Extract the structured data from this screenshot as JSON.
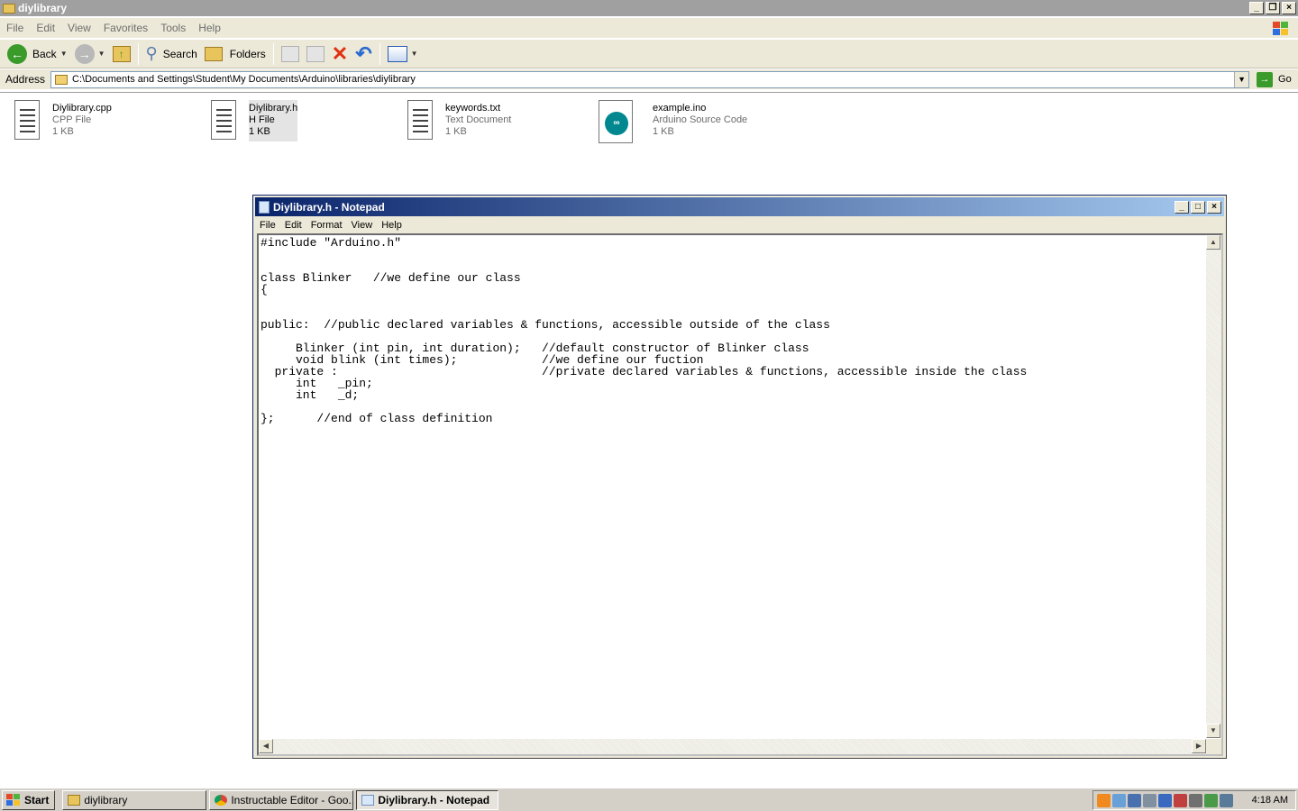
{
  "explorer": {
    "title": "diylibrary",
    "menu": [
      "File",
      "Edit",
      "View",
      "Favorites",
      "Tools",
      "Help"
    ],
    "toolbar": {
      "back": "Back",
      "search": "Search",
      "folders": "Folders"
    },
    "address": {
      "label": "Address",
      "value": "C:\\Documents and Settings\\Student\\My Documents\\Arduino\\libraries\\diylibrary",
      "go": "Go"
    },
    "files": [
      {
        "name": "Diylibrary.cpp",
        "type": "CPP File",
        "size": "1 KB"
      },
      {
        "name": "Diylibrary.h",
        "type": "H File",
        "size": "1 KB"
      },
      {
        "name": "keywords.txt",
        "type": "Text Document",
        "size": "1 KB"
      },
      {
        "name": "example.ino",
        "type": "Arduino Source Code",
        "size": "1 KB"
      }
    ]
  },
  "notepad": {
    "title": "Diylibrary.h - Notepad",
    "menu": [
      "File",
      "Edit",
      "Format",
      "View",
      "Help"
    ],
    "content": "#include \"Arduino.h\"\n\n\nclass Blinker   //we define our class\n{\n\n\npublic:  //public declared variables & functions, accessible outside of the class\n\n     Blinker (int pin, int duration);   //default constructor of Blinker class\n     void blink (int times);            //we define our fuction\n  private :                             //private declared variables & functions, accessible inside the class\n     int   _pin;\n     int   _d;\n\n};      //end of class definition"
  },
  "taskbar": {
    "start": "Start",
    "tasks": [
      "diylibrary",
      "Instructable Editor - Goo...",
      "Diylibrary.h - Notepad"
    ],
    "clock": "4:18 AM"
  },
  "colors": {
    "notepad_title_start": "#0a246a",
    "notepad_title_end": "#a6caf0",
    "arduino_teal": "#00878f"
  }
}
